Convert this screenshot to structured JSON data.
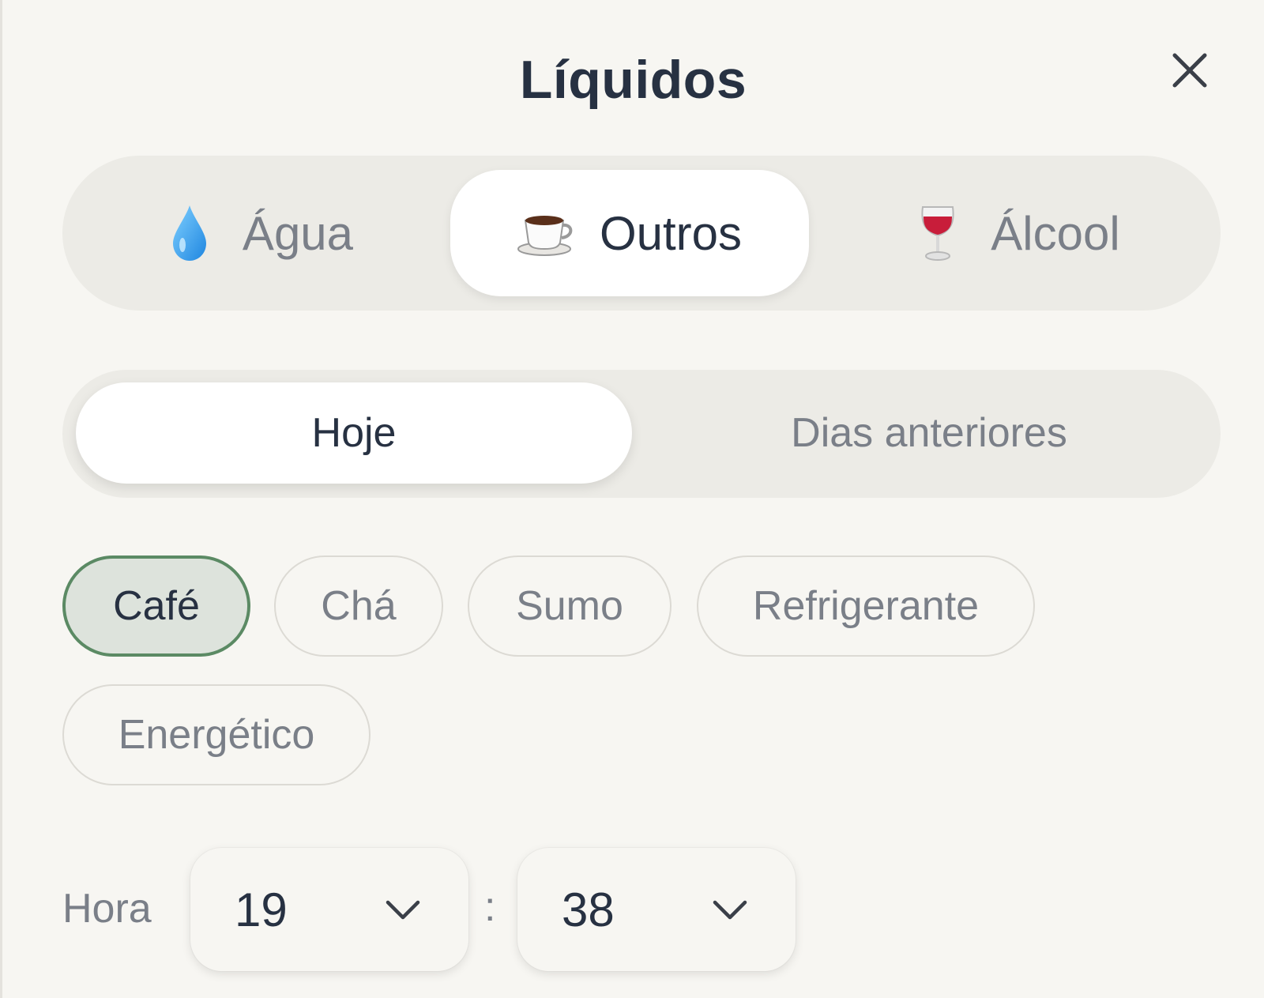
{
  "dialog": {
    "title": "Líquidos",
    "close_icon": "close-icon"
  },
  "category_tabs": [
    {
      "label": "Água",
      "icon": "water-drop-icon",
      "active": false
    },
    {
      "label": "Outros",
      "icon": "coffee-cup-icon",
      "active": true
    },
    {
      "label": "Álcool",
      "icon": "wine-glass-icon",
      "active": false
    }
  ],
  "day_tabs": [
    {
      "label": "Hoje",
      "active": true
    },
    {
      "label": "Dias anteriores",
      "active": false
    }
  ],
  "drink_types": [
    {
      "label": "Café",
      "selected": true
    },
    {
      "label": "Chá",
      "selected": false
    },
    {
      "label": "Sumo",
      "selected": false
    },
    {
      "label": "Refrigerante",
      "selected": false
    },
    {
      "label": "Energético",
      "selected": false
    }
  ],
  "time": {
    "label": "Hora",
    "hour": "19",
    "separator": ":",
    "minute": "38"
  },
  "colors": {
    "background": "#f7f6f2",
    "segment_bg": "#ecebe6",
    "selected_chip_bg": "#dde3dc",
    "selected_chip_border": "#5b8a64",
    "text_dark": "#273142",
    "text_muted": "#7a7f88"
  }
}
